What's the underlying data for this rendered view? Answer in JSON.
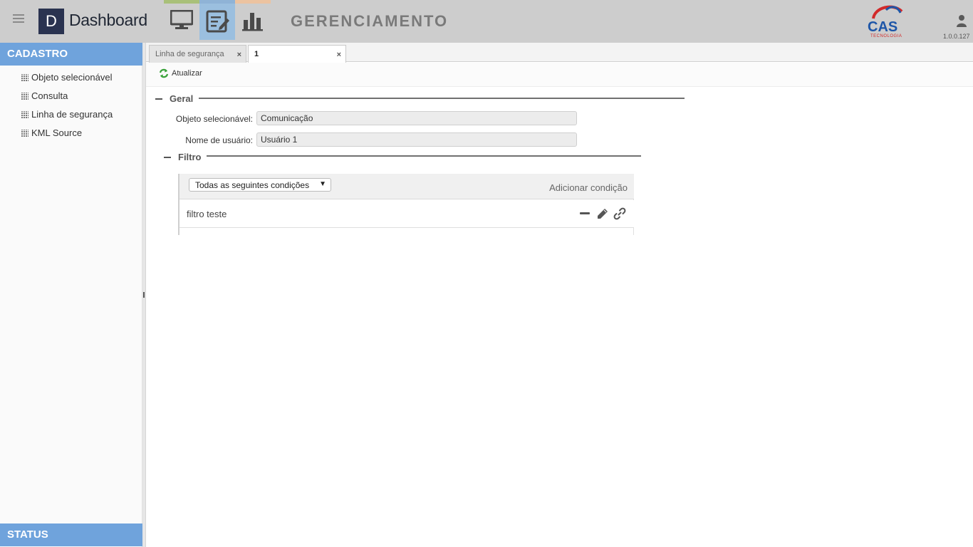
{
  "header": {
    "logo_letter": "D",
    "app_title": "Dashboard",
    "section_title": "GERENCIAMENTO",
    "version": "1.0.0.127",
    "brand_name": "CAS",
    "brand_sub": "TECNOLOGIA"
  },
  "sidebar": {
    "cadastro_label": "CADASTRO",
    "items": [
      {
        "label": "Objeto selecionável"
      },
      {
        "label": "Consulta"
      },
      {
        "label": "Linha de segurança"
      },
      {
        "label": "KML Source"
      }
    ],
    "status_label": "STATUS"
  },
  "tabs": [
    {
      "label": "Linha de segurança",
      "close": "×"
    },
    {
      "label": "1",
      "close": "×"
    }
  ],
  "toolbar": {
    "refresh_label": "Atualizar"
  },
  "form": {
    "geral_legend": "Geral",
    "objeto_label": "Objeto selecionável:",
    "objeto_value": "Comunicação",
    "nome_label": "Nome de usuário:",
    "nome_value": "Usuário 1"
  },
  "filtro": {
    "legend": "Filtro",
    "condition_selected": "Todas as seguintes condições",
    "add_condition": "Adicionar condição",
    "rows": [
      {
        "label": "filtro teste"
      }
    ]
  },
  "colors": {
    "header_bg": "#cdcdcd",
    "sidebar_header": "#6fa3dc",
    "mode_monitor": "#a9c079",
    "mode_edit": "#9bbfdf",
    "mode_chart": "#ecc3a0"
  }
}
